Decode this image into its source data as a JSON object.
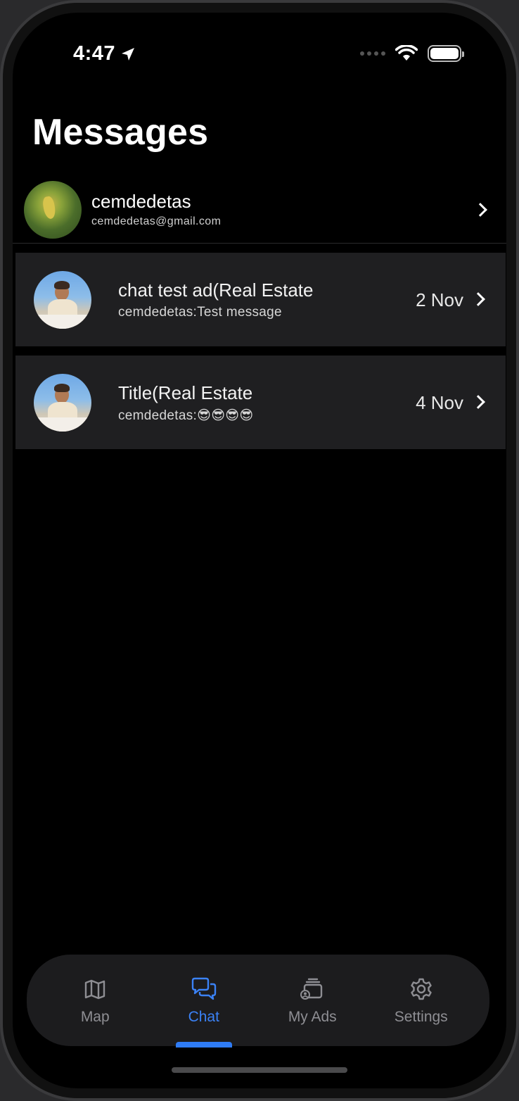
{
  "status_bar": {
    "time": "4:47",
    "icons": [
      "location-arrow-icon",
      "cellular-signal-icon",
      "wifi-icon",
      "battery-icon"
    ]
  },
  "page": {
    "title": "Messages"
  },
  "profile": {
    "name": "cemdedetas",
    "email": "cemdedetas@gmail.com"
  },
  "chats": [
    {
      "title": "chat test ad(Real Estate",
      "preview": "cemdedetas:Test message",
      "date": "2 Nov"
    },
    {
      "title": "Title(Real Estate",
      "preview": "cemdedetas:😎😎😎😎",
      "date": "4 Nov"
    }
  ],
  "tab_bar": {
    "active": "Chat",
    "accent_color": "#3b82f6",
    "tabs": [
      {
        "label": "Map",
        "icon": "map-icon"
      },
      {
        "label": "Chat",
        "icon": "chat-bubbles-icon"
      },
      {
        "label": "My Ads",
        "icon": "my-ads-icon"
      },
      {
        "label": "Settings",
        "icon": "gear-icon"
      }
    ]
  }
}
